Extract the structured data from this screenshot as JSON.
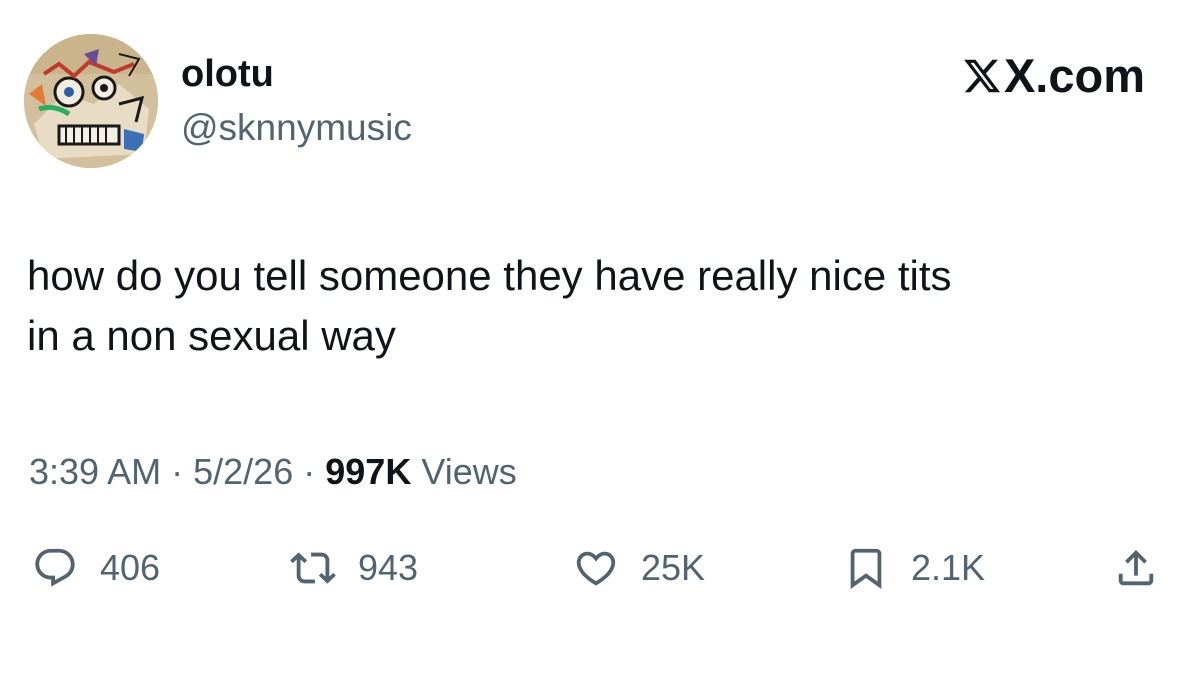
{
  "author": {
    "display_name": "olotu",
    "handle": "@sknnymusic"
  },
  "brand": {
    "domain": "X.com",
    "icon": "x-logo-icon"
  },
  "tweet": {
    "text": "how do you tell someone they have really nice tits\nin a non sexual way"
  },
  "meta": {
    "time": "3:39 AM",
    "separator": "·",
    "date": "5/2/26",
    "views_count": "997K",
    "views_label": "Views"
  },
  "actions": {
    "replies": "406",
    "retweets": "943",
    "likes": "25K",
    "bookmarks": "2.1K"
  },
  "icons": {
    "reply": "reply-icon",
    "retweet": "retweet-icon",
    "like": "heart-icon",
    "bookmark": "bookmark-icon",
    "share": "share-icon"
  },
  "colors": {
    "text_primary": "#0f1419",
    "text_secondary": "#536471",
    "background": "#ffffff"
  }
}
